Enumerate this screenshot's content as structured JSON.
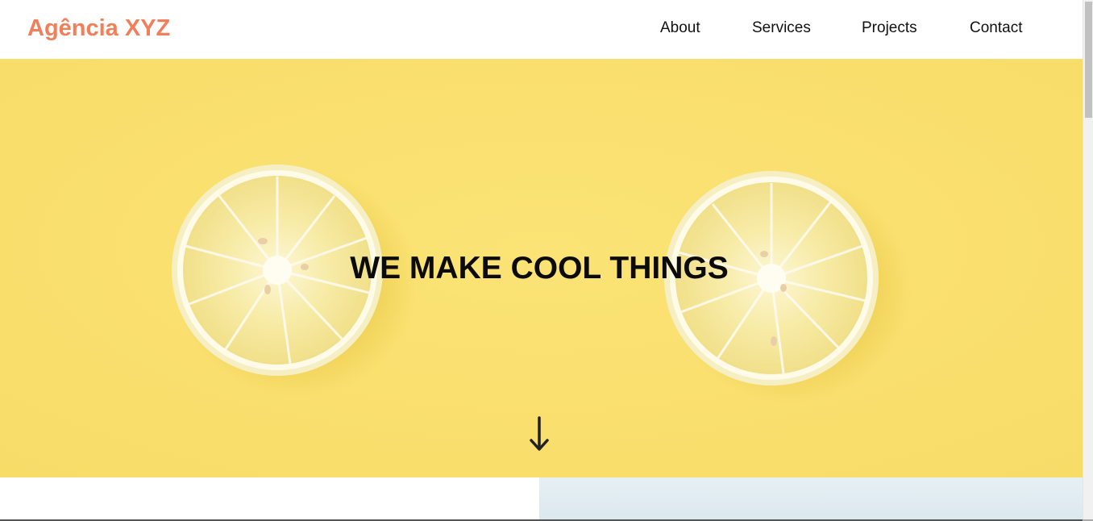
{
  "header": {
    "brand": "Agência XYZ",
    "nav": [
      "About",
      "Services",
      "Projects",
      "Contact"
    ]
  },
  "hero": {
    "title": "WE MAKE COOL THINGS",
    "scroll_icon": "arrow-down-icon",
    "background_image": "two lemon slices on yellow background"
  },
  "colors": {
    "brand": "#f07f5a",
    "hero_bg": "#f9df70",
    "text": "#111111"
  }
}
